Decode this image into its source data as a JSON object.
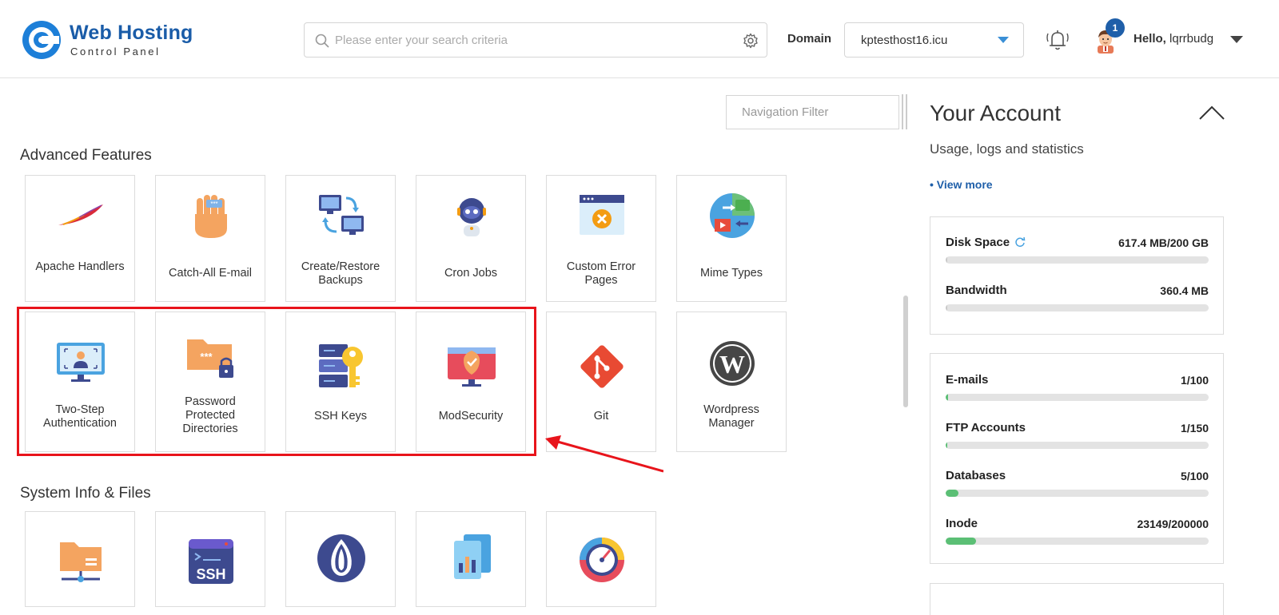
{
  "header": {
    "logo_title": "Web Hosting",
    "logo_subtitle": "Control Panel",
    "search_placeholder": "Please enter your search criteria",
    "domain_label": "Domain",
    "domain_value": "kptesthost16.icu",
    "notification_count": "1",
    "hello_prefix": "Hello,",
    "username": "lqrrbudg"
  },
  "main": {
    "nav_filter_placeholder": "Navigation Filter",
    "sections": [
      {
        "title": "Advanced Features",
        "tiles": [
          {
            "label": "Apache Handlers",
            "icon": "apache-feather-icon"
          },
          {
            "label": "Catch-All E-mail",
            "icon": "hand-icon"
          },
          {
            "label": "Create/Restore Backups",
            "icon": "backup-computers-icon"
          },
          {
            "label": "Cron Jobs",
            "icon": "robot-icon"
          },
          {
            "label": "Custom Error Pages",
            "icon": "error-page-icon"
          },
          {
            "label": "Mime Types",
            "icon": "mime-globe-icon"
          },
          {
            "label": "Two-Step Authentication",
            "icon": "two-step-monitor-icon"
          },
          {
            "label": "Password Protected Directories",
            "icon": "locked-folder-icon"
          },
          {
            "label": "SSH Keys",
            "icon": "server-key-icon"
          },
          {
            "label": "ModSecurity",
            "icon": "shield-monitor-icon"
          },
          {
            "label": "Git",
            "icon": "git-icon"
          },
          {
            "label": "Wordpress Manager",
            "icon": "wordpress-icon"
          }
        ]
      },
      {
        "title": "System Info & Files",
        "tiles": [
          {
            "label": "",
            "icon": "network-folder-icon"
          },
          {
            "label": "",
            "icon": "ssh-terminal-icon"
          },
          {
            "label": "",
            "icon": "perl-onion-icon"
          },
          {
            "label": "",
            "icon": "file-stats-icon"
          },
          {
            "label": "",
            "icon": "speed-gauge-icon"
          }
        ]
      }
    ]
  },
  "sidebar": {
    "title": "Your Account",
    "subtitle": "Usage, logs and statistics",
    "view_more": "• View more",
    "box1": [
      {
        "label": "Disk Space",
        "value": "617.4 MB/200 GB",
        "percent": 0.3
      },
      {
        "label": "Bandwidth",
        "value": "360.4 MB",
        "percent": 0
      }
    ],
    "box2": [
      {
        "label": "E-mails",
        "value": "1/100",
        "percent": 1
      },
      {
        "label": "FTP Accounts",
        "value": "1/150",
        "percent": 0.7
      },
      {
        "label": "Databases",
        "value": "5/100",
        "percent": 5
      },
      {
        "label": "Inode",
        "value": "23149/200000",
        "percent": 11.6
      }
    ]
  },
  "colors": {
    "brand": "#1a5ca8",
    "highlight": "#e8141b",
    "progress": "#5bbf75",
    "link": "#1f5fa9"
  }
}
